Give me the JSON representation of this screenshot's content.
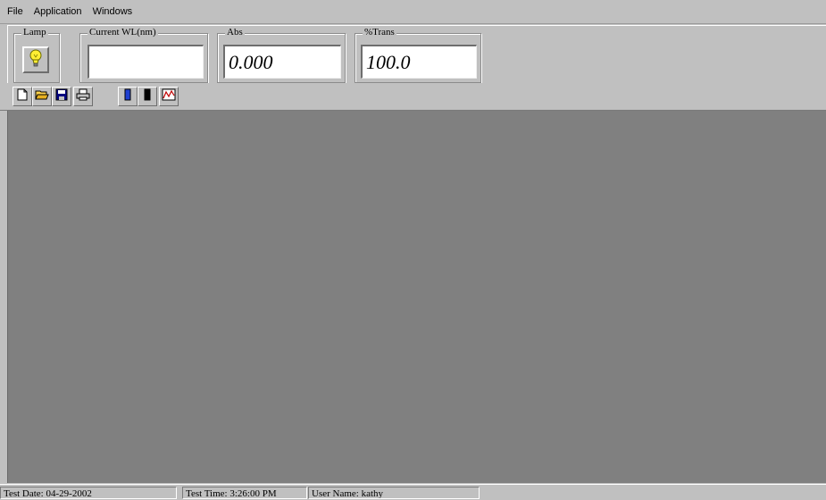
{
  "menu": [
    "File",
    "Application",
    "Windows"
  ],
  "readout": {
    "lamp_label": "Lamp",
    "wavelength_label": "Current WL(nm)",
    "wavelength_value": "",
    "abs_label": "Abs",
    "abs_value": "0.000",
    "trans_label": "%Trans",
    "trans_value": "100.0"
  },
  "toolbar": {
    "buttons": [
      "new-file-icon",
      "open-folder-icon",
      "save-disk-icon",
      "print-icon",
      "blank-cuvette-icon",
      "sample-cuvette-icon",
      "scan-graph-icon"
    ]
  },
  "status": {
    "test_date": "Test Date: 04-29-2002",
    "test_time": "Test Time: 3:26:00 PM",
    "user_name": "User Name: kathy"
  },
  "colors": {
    "window_face": "#c0c0c0",
    "workspace": "#808080",
    "lamp_bulb": "#ffee33",
    "blank_cuvette": "#1e3fd0",
    "sample_cuvette": "#000000"
  }
}
